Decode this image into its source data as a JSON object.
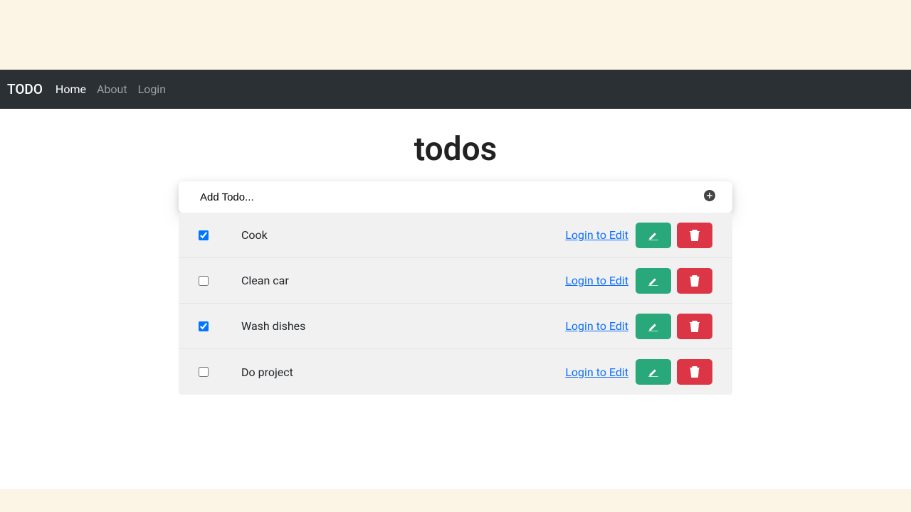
{
  "nav": {
    "brand": "TODO",
    "links": [
      {
        "label": "Home",
        "active": true
      },
      {
        "label": "About",
        "active": false
      },
      {
        "label": "Login",
        "active": false
      }
    ]
  },
  "page_title": "todos",
  "add_placeholder": "Add Todo...",
  "login_to_edit_label": "Login to Edit",
  "todos": [
    {
      "label": "Cook",
      "checked": true
    },
    {
      "label": "Clean car",
      "checked": false
    },
    {
      "label": "Wash dishes",
      "checked": true
    },
    {
      "label": "Do project",
      "checked": false
    }
  ]
}
